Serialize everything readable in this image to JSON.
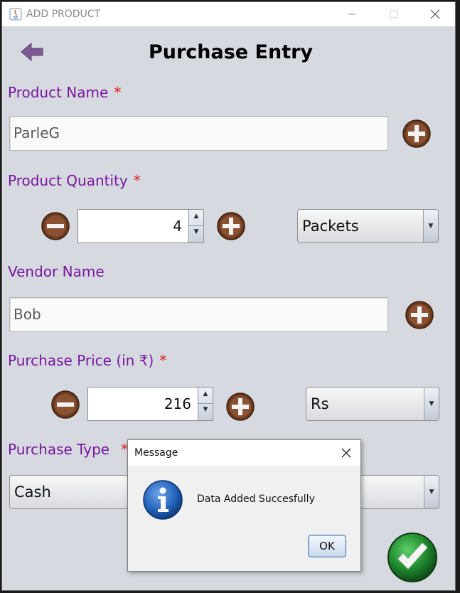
{
  "window": {
    "title": "ADD PRODUCT",
    "controls": [
      "minimize-icon",
      "maximize-icon",
      "close-icon"
    ]
  },
  "page": {
    "heading": "Purchase Entry",
    "back_icon": "back-arrow-icon"
  },
  "form": {
    "product_name": {
      "label": "Product Name",
      "required": "*",
      "value": "ParleG"
    },
    "product_quantity": {
      "label": "Product Quantity",
      "required": "*",
      "value": "4",
      "unit": "Packets"
    },
    "vendor_name": {
      "label": "Vendor Name",
      "value": "Bob"
    },
    "purchase_price": {
      "label": "Purchase Price (in ₹)",
      "required": "*",
      "value": "216",
      "currency": "Rs"
    },
    "purchase_type": {
      "label": "Purchase Type",
      "required": "*",
      "value": "Cash"
    }
  },
  "dialog": {
    "title": "Message",
    "message": "Data Added Succesfully",
    "ok_label": "OK",
    "icon": "info-icon"
  },
  "colors": {
    "label": "#7a16a0",
    "required": "#e01f1f",
    "round_button": "#6b3a1f",
    "submit": "#1f8a2e",
    "window_bg": "#d6d9df"
  }
}
